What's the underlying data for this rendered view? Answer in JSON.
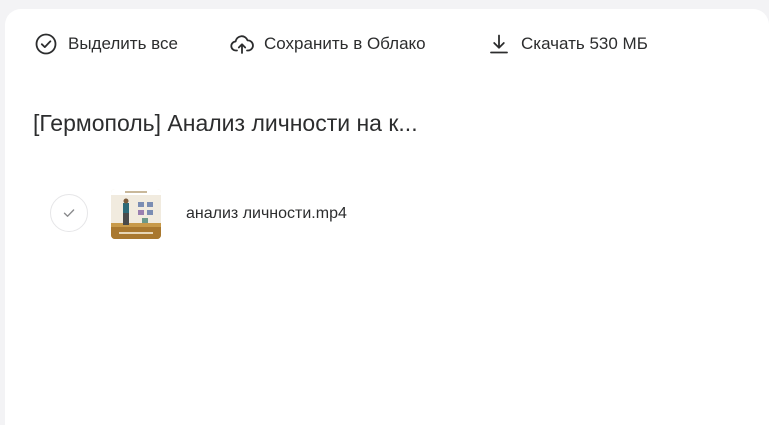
{
  "toolbar": {
    "select_all": {
      "label": "Выделить все",
      "icon": "check-circle-icon"
    },
    "save_to_cloud": {
      "label": "Сохранить в Облако",
      "icon": "cloud-upload-icon"
    },
    "download": {
      "label": "Скачать 530 МБ",
      "icon": "download-icon"
    }
  },
  "folder": {
    "title": "[Гермополь] Анализ личности на к..."
  },
  "files": [
    {
      "name": "анализ личности.mp4",
      "thumbnail": "video-thumbnail",
      "selected": false
    }
  ],
  "colors": {
    "text": "#2c2d2e",
    "background": "#f3f3f5",
    "panel": "#ffffff",
    "checkbox_border": "#e6e6e8",
    "checkmark": "#8a8b8d"
  }
}
